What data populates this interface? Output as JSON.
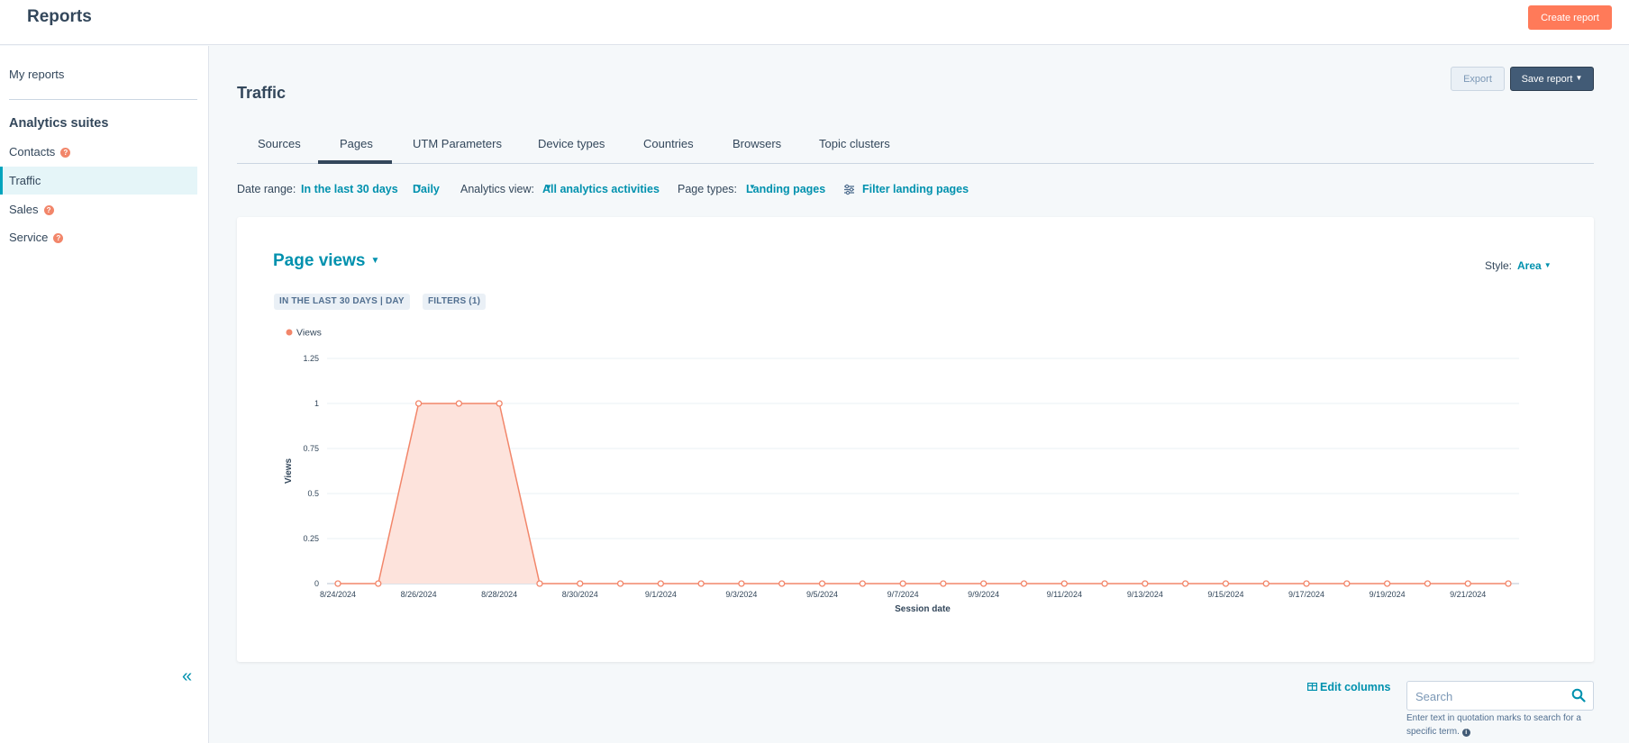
{
  "header": {
    "title": "Reports",
    "create_label": "Create report"
  },
  "sidebar": {
    "my_reports": "My reports",
    "section_title": "Analytics suites",
    "items": [
      {
        "label": "Contacts",
        "help": true,
        "active": false
      },
      {
        "label": "Traffic",
        "help": false,
        "active": true
      },
      {
        "label": "Sales",
        "help": true,
        "active": false
      },
      {
        "label": "Service",
        "help": true,
        "active": false
      }
    ],
    "collapse_icon": "double-chevron-left-icon"
  },
  "main": {
    "title": "Traffic",
    "export_label": "Export",
    "save_label": "Save report",
    "tabs": [
      {
        "label": "Sources",
        "active": false
      },
      {
        "label": "Pages",
        "active": true
      },
      {
        "label": "UTM Parameters",
        "active": false
      },
      {
        "label": "Device types",
        "active": false
      },
      {
        "label": "Countries",
        "active": false
      },
      {
        "label": "Browsers",
        "active": false
      },
      {
        "label": "Topic clusters",
        "active": false
      }
    ],
    "filters": {
      "date_range_label": "Date range:",
      "date_range_value": "In the last 30 days",
      "frequency_value": "Daily",
      "analytics_view_label": "Analytics view:",
      "analytics_view_value": "All analytics activities",
      "page_types_label": "Page types:",
      "page_types_value": "Landing pages",
      "filter_link": "Filter landing pages"
    }
  },
  "card": {
    "metric": "Page views",
    "style_label": "Style:",
    "style_value": "Area",
    "pill_range": "IN THE LAST 30 DAYS | DAY",
    "pill_filters": "FILTERS (1)"
  },
  "chart_data": {
    "type": "area",
    "xlabel": "Session date",
    "ylabel": "Views",
    "ylim": [
      0,
      1.25
    ],
    "yticks": [
      "0",
      "0.25",
      "0.5",
      "0.75",
      "1",
      "1.25"
    ],
    "grid": true,
    "legend": "top-left",
    "color": "#f2866a",
    "fill": "#fde3dc",
    "x": [
      "8/24/2024",
      "8/25/2024",
      "8/26/2024",
      "8/27/2024",
      "8/28/2024",
      "8/29/2024",
      "8/30/2024",
      "8/31/2024",
      "9/1/2024",
      "9/2/2024",
      "9/3/2024",
      "9/4/2024",
      "9/5/2024",
      "9/6/2024",
      "9/7/2024",
      "9/8/2024",
      "9/9/2024",
      "9/10/2024",
      "9/11/2024",
      "9/12/2024",
      "9/13/2024",
      "9/14/2024",
      "9/15/2024",
      "9/16/2024",
      "9/17/2024",
      "9/18/2024",
      "9/19/2024",
      "9/20/2024",
      "9/21/2024",
      "9/22/2024"
    ],
    "xtick_labels": [
      "8/24/2024",
      "8/26/2024",
      "8/28/2024",
      "8/30/2024",
      "9/1/2024",
      "9/3/2024",
      "9/5/2024",
      "9/7/2024",
      "9/9/2024",
      "9/11/2024",
      "9/13/2024",
      "9/15/2024",
      "9/17/2024",
      "9/19/2024",
      "9/21/2024"
    ],
    "series": [
      {
        "name": "Views",
        "values": [
          0,
          0,
          1,
          1,
          1,
          0,
          0,
          0,
          0,
          0,
          0,
          0,
          0,
          0,
          0,
          0,
          0,
          0,
          0,
          0,
          0,
          0,
          0,
          0,
          0,
          0,
          0,
          0,
          0,
          0
        ]
      }
    ]
  },
  "table_tools": {
    "edit_columns": "Edit columns",
    "search_placeholder": "Search",
    "search_hint": "Enter text in quotation marks to search for a specific term."
  }
}
